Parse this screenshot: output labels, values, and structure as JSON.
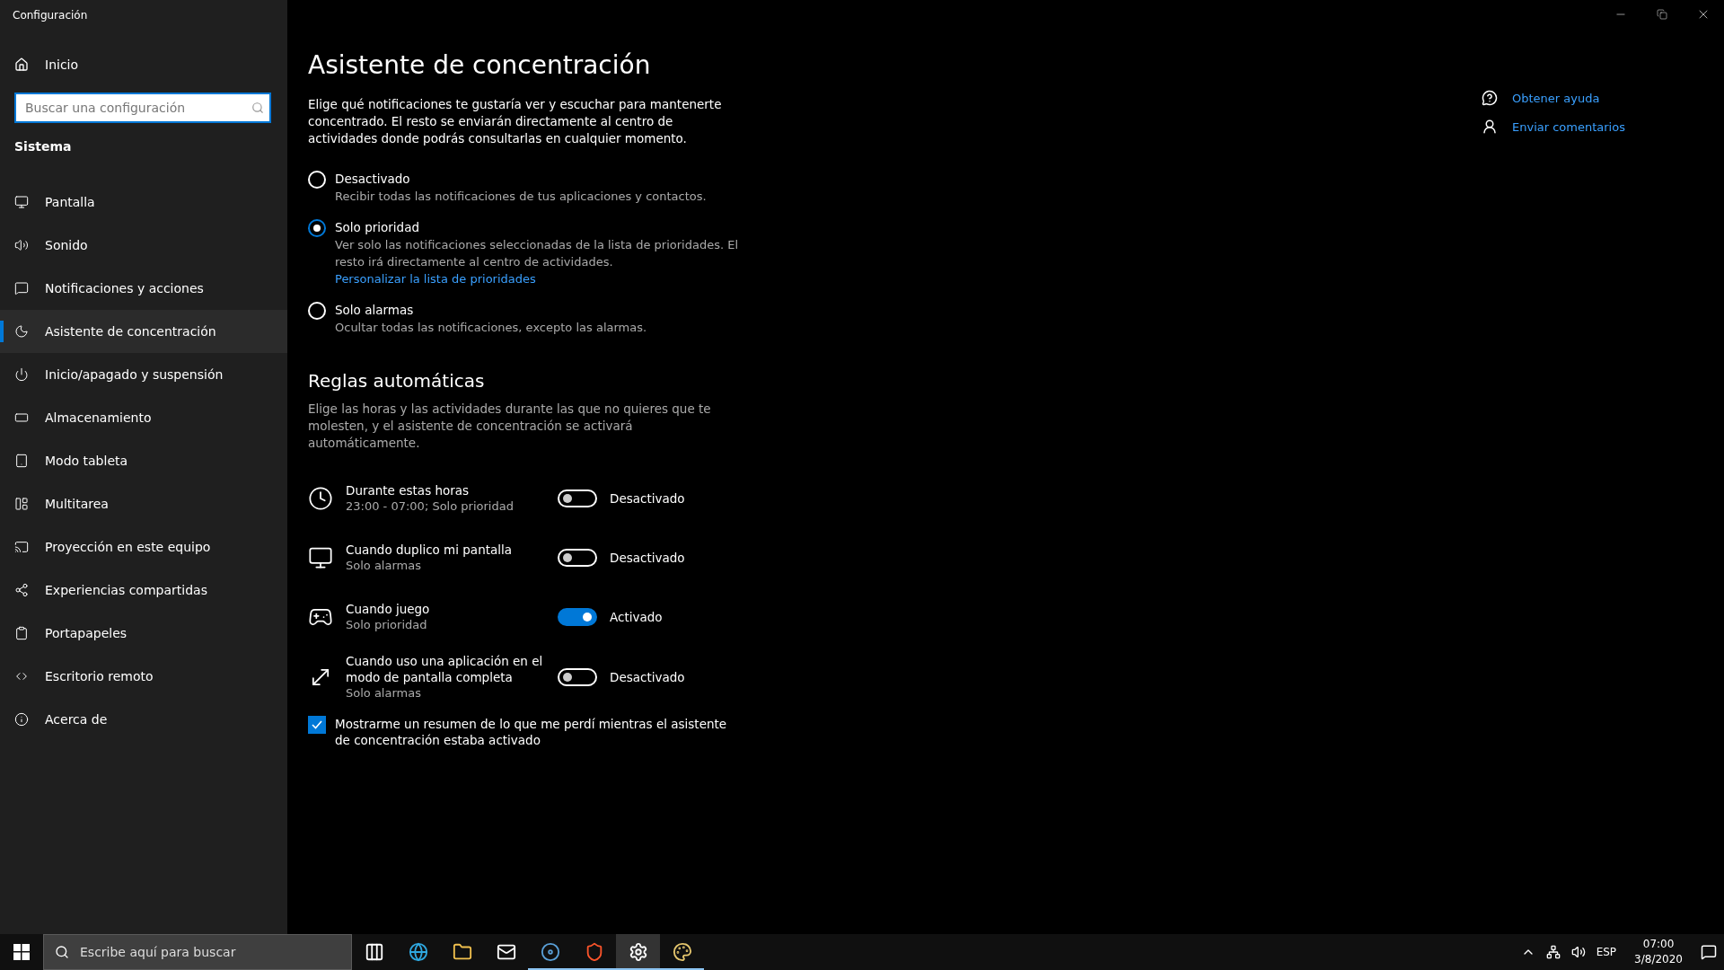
{
  "window": {
    "title": "Configuración"
  },
  "sidebar": {
    "home": "Inicio",
    "search": {
      "placeholder": "Buscar una configuración"
    },
    "section": "Sistema",
    "items": [
      {
        "label": "Pantalla",
        "selected": false
      },
      {
        "label": "Sonido",
        "selected": false
      },
      {
        "label": "Notificaciones y acciones",
        "selected": false
      },
      {
        "label": "Asistente de concentración",
        "selected": true
      },
      {
        "label": "Inicio/apagado y suspensión",
        "selected": false
      },
      {
        "label": "Almacenamiento",
        "selected": false
      },
      {
        "label": "Modo tableta",
        "selected": false
      },
      {
        "label": "Multitarea",
        "selected": false
      },
      {
        "label": "Proyección en este equipo",
        "selected": false
      },
      {
        "label": "Experiencias compartidas",
        "selected": false
      },
      {
        "label": "Portapapeles",
        "selected": false
      },
      {
        "label": "Escritorio remoto",
        "selected": false
      },
      {
        "label": "Acerca de",
        "selected": false
      }
    ]
  },
  "page": {
    "title": "Asistente de concentración",
    "description": "Elige qué notificaciones te gustaría ver y escuchar para mantenerte concentrado. El resto se enviarán directamente al centro de actividades donde podrás consultarlas en cualquier momento.",
    "modes": [
      {
        "label": "Desactivado",
        "description": "Recibir todas las notificaciones de tus aplicaciones y contactos.",
        "selected": false
      },
      {
        "label": "Solo prioridad",
        "description": "Ver solo las notificaciones seleccionadas de la lista de prioridades. El resto irá directamente al centro de actividades.",
        "link": "Personalizar la lista de prioridades",
        "selected": true
      },
      {
        "label": "Solo alarmas",
        "description": "Ocultar todas las notificaciones, excepto las alarmas.",
        "selected": false
      }
    ],
    "rules_title": "Reglas automáticas",
    "rules_description": "Elige las horas y las actividades durante las que no quieres que te molesten, y el asistente de concentración se activará automáticamente.",
    "rules": [
      {
        "title": "Durante estas horas",
        "subtitle": "23:00 - 07:00; Solo prioridad",
        "on": false,
        "state_label": "Desactivado"
      },
      {
        "title": "Cuando duplico mi pantalla",
        "subtitle": "Solo alarmas",
        "on": false,
        "state_label": "Desactivado"
      },
      {
        "title": "Cuando juego",
        "subtitle": "Solo prioridad",
        "on": true,
        "state_label": "Activado"
      },
      {
        "title": "Cuando uso una aplicación en el modo de pantalla completa",
        "subtitle": "Solo alarmas",
        "on": false,
        "state_label": "Desactivado"
      }
    ],
    "summary": {
      "label": "Mostrarme un resumen de lo que me perdí mientras el asistente de concentración estaba activado",
      "checked": true
    },
    "help_links": [
      "Obtener ayuda",
      "Enviar comentarios"
    ]
  },
  "taskbar": {
    "search_placeholder": "Escribe aquí para buscar",
    "apps": [
      {
        "kind": "taskview",
        "running": false,
        "active": false
      },
      {
        "kind": "edge",
        "running": false,
        "active": false
      },
      {
        "kind": "folder",
        "running": false,
        "active": false
      },
      {
        "kind": "mail",
        "running": false,
        "active": false
      },
      {
        "kind": "steam",
        "running": true,
        "active": false
      },
      {
        "kind": "brave",
        "running": true,
        "active": false
      },
      {
        "kind": "settings",
        "running": true,
        "active": true
      },
      {
        "kind": "paint",
        "running": true,
        "active": false
      }
    ],
    "language": "ESP",
    "time": "07:00",
    "date": "3/8/2020"
  }
}
